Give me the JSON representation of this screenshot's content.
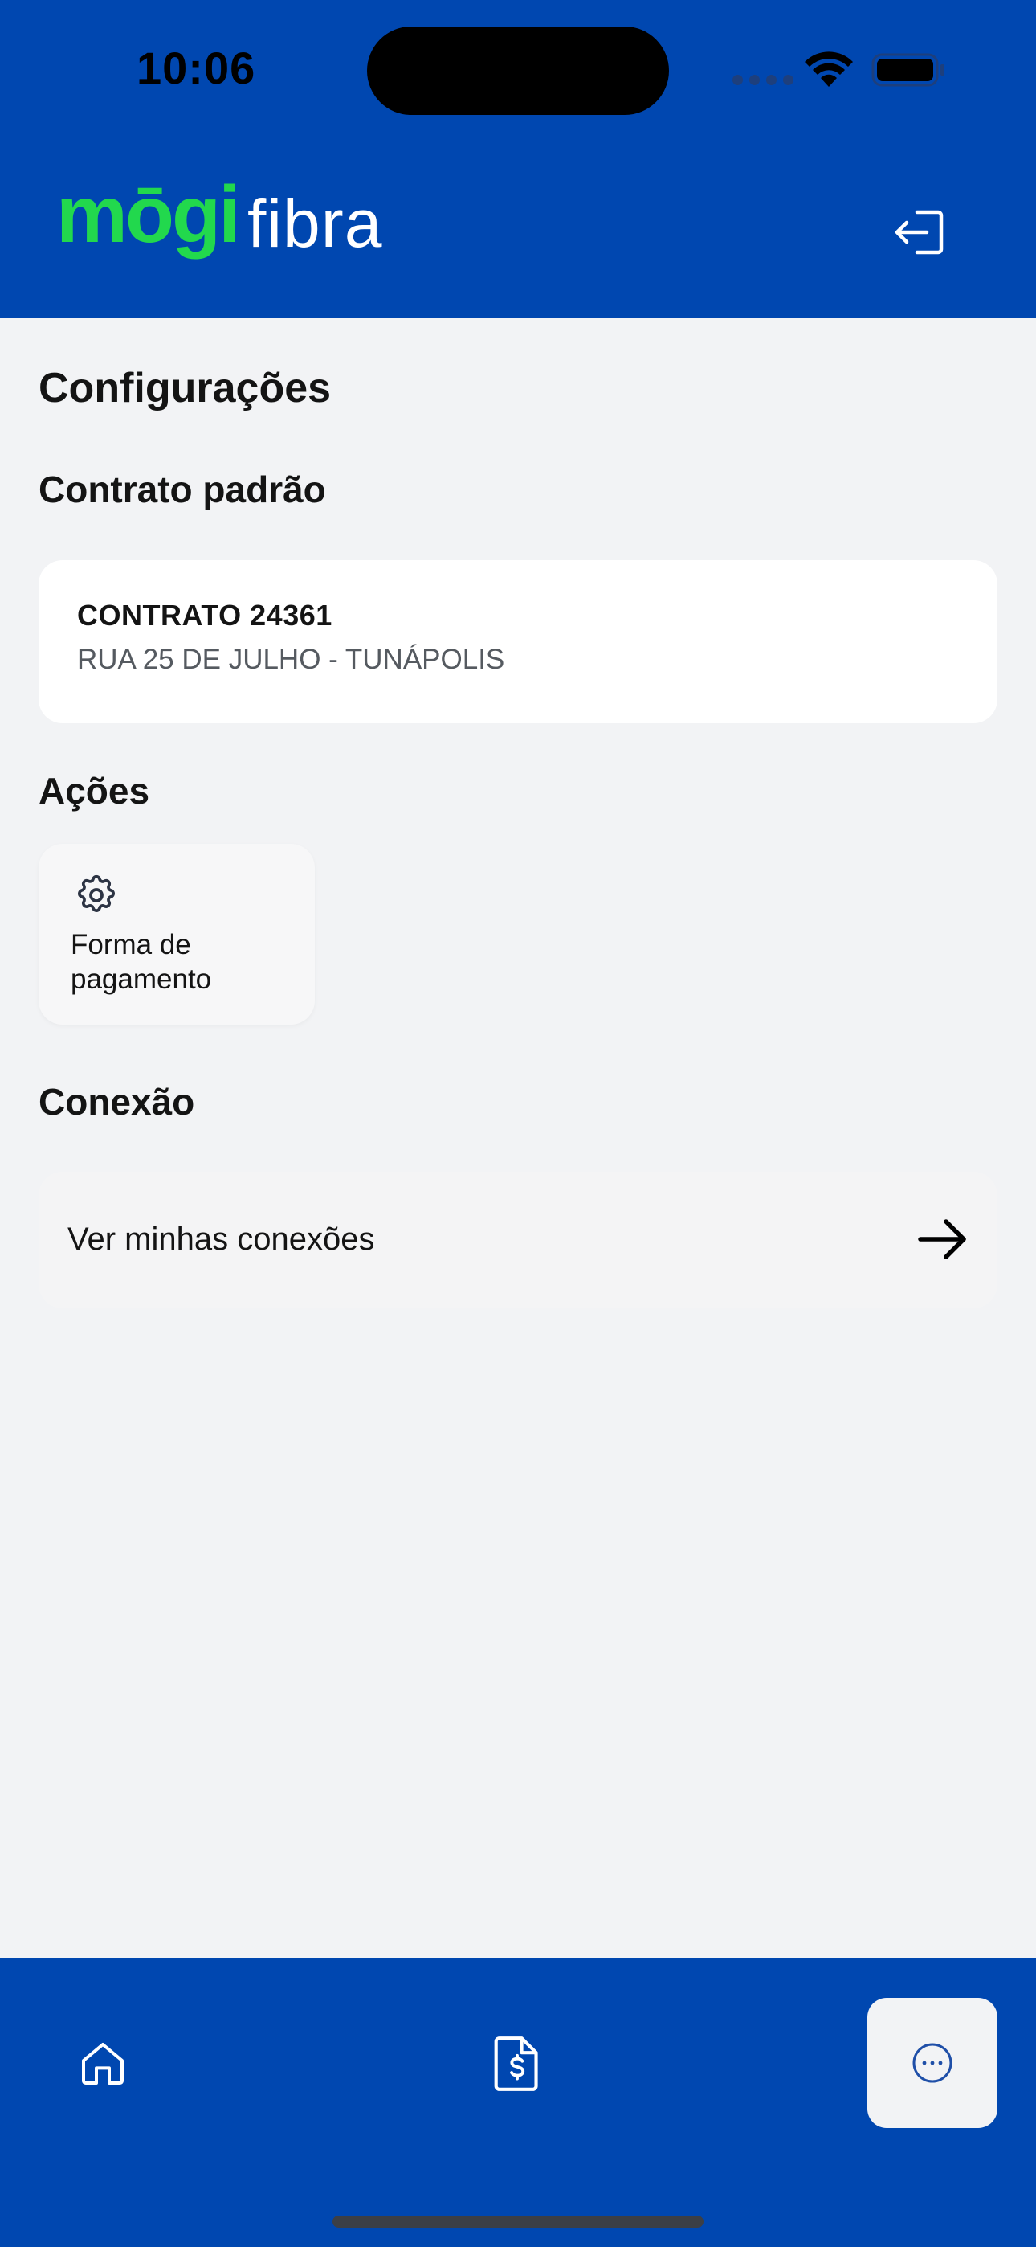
{
  "status_bar": {
    "time": "10:06"
  },
  "header": {
    "logo_main": "mōgi",
    "logo_sub": "fibra",
    "logout_icon": "logout-icon",
    "background_color": "#0047b0",
    "logo_color": "#22d84d"
  },
  "page": {
    "title": "Configurações"
  },
  "default_contract": {
    "section_title": "Contrato padrão",
    "name": "CONTRATO 24361",
    "address": "RUA 25 DE JULHO - TUNÁPOLIS"
  },
  "actions": {
    "section_title": "Ações",
    "items": [
      {
        "icon": "gear-icon",
        "label": "Forma de pagamento"
      }
    ]
  },
  "connection": {
    "section_title": "Conexão",
    "link_label": "Ver minhas conexões",
    "icon": "arrow-right-icon"
  },
  "bottom_nav": {
    "items": [
      {
        "icon": "home-icon",
        "active": false
      },
      {
        "icon": "invoice-icon",
        "active": false
      },
      {
        "icon": "more-icon",
        "active": true
      }
    ]
  }
}
